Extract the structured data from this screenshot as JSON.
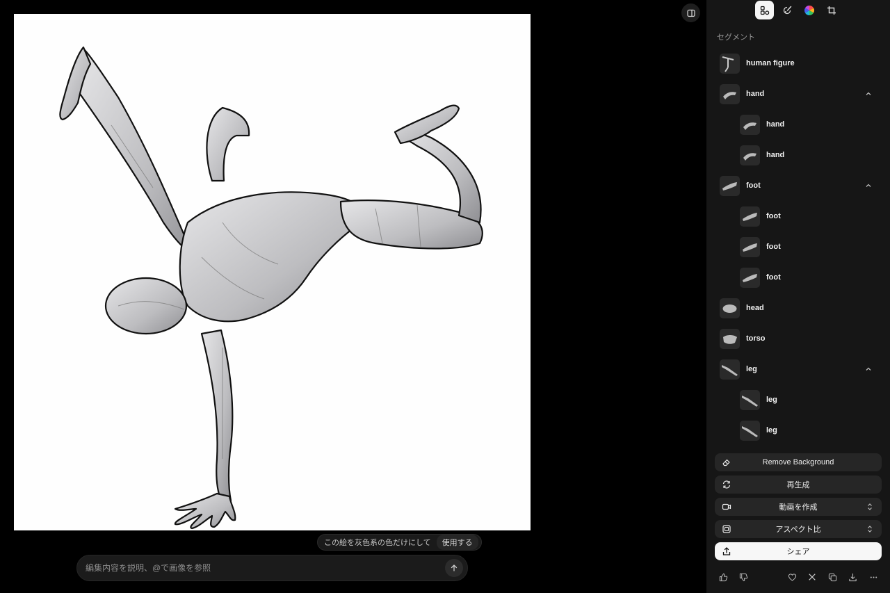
{
  "sidebar": {
    "section_title": "セグメント",
    "segments": [
      {
        "label": "human figure",
        "expanded": null,
        "children": []
      },
      {
        "label": "hand",
        "expanded": true,
        "children": [
          "hand",
          "hand"
        ]
      },
      {
        "label": "foot",
        "expanded": true,
        "children": [
          "foot",
          "foot",
          "foot"
        ]
      },
      {
        "label": "head",
        "expanded": null,
        "children": []
      },
      {
        "label": "torso",
        "expanded": null,
        "children": []
      },
      {
        "label": "leg",
        "expanded": true,
        "children": [
          "leg",
          "leg"
        ]
      }
    ],
    "tools": [
      "segment-icon",
      "paint-brush-icon",
      "color-wheel-icon",
      "crop-icon"
    ],
    "actions": {
      "remove_bg": "Remove Background",
      "regenerate": "再生成",
      "make_video": "動画を作成",
      "aspect": "アスペクト比",
      "share": "シェア"
    }
  },
  "suggestion": {
    "text": "この絵を灰色系の色だけにして",
    "use": "使用する"
  },
  "prompt": {
    "placeholder": "編集内容を説明、@で画像を参照"
  },
  "colors": {
    "panel_bg": "#161616",
    "button_bg": "#262626",
    "primary_bg": "#f7f7f7"
  }
}
